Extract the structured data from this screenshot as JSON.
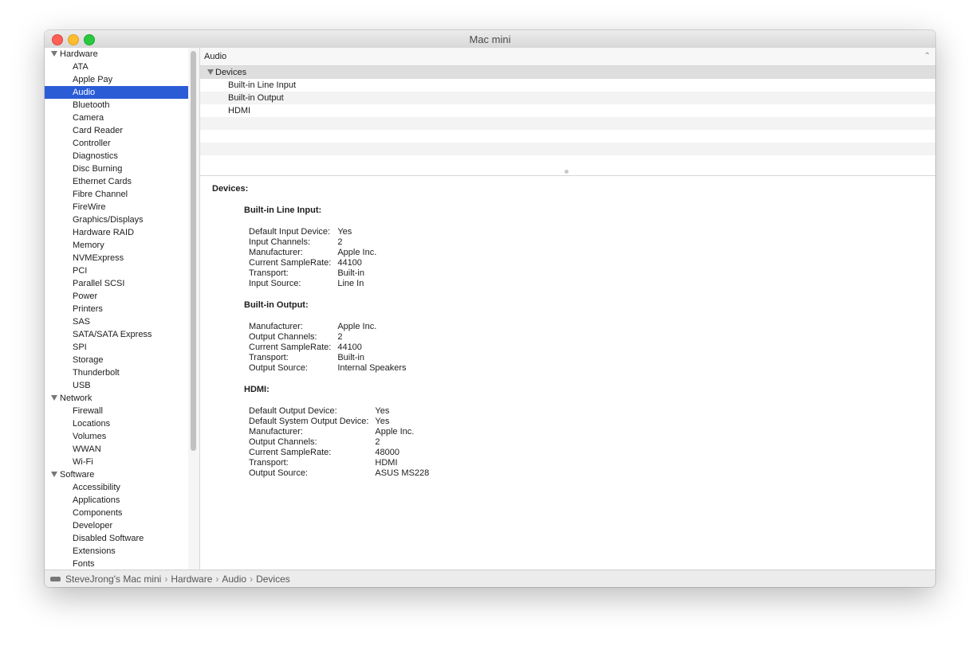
{
  "window": {
    "title": "Mac mini"
  },
  "sidebar": {
    "groups": [
      {
        "label": "Hardware",
        "items": [
          "ATA",
          "Apple Pay",
          "Audio",
          "Bluetooth",
          "Camera",
          "Card Reader",
          "Controller",
          "Diagnostics",
          "Disc Burning",
          "Ethernet Cards",
          "Fibre Channel",
          "FireWire",
          "Graphics/Displays",
          "Hardware RAID",
          "Memory",
          "NVMExpress",
          "PCI",
          "Parallel SCSI",
          "Power",
          "Printers",
          "SAS",
          "SATA/SATA Express",
          "SPI",
          "Storage",
          "Thunderbolt",
          "USB"
        ]
      },
      {
        "label": "Network",
        "items": [
          "Firewall",
          "Locations",
          "Volumes",
          "WWAN",
          "Wi-Fi"
        ]
      },
      {
        "label": "Software",
        "items": [
          "Accessibility",
          "Applications",
          "Components",
          "Developer",
          "Disabled Software",
          "Extensions",
          "Fonts"
        ]
      }
    ],
    "selected": "Audio"
  },
  "main": {
    "header": "Audio",
    "device_group": "Devices",
    "devices": [
      "Built-in Line Input",
      "Built-in Output",
      "HDMI"
    ],
    "details": {
      "heading": "Devices:",
      "sections": [
        {
          "title": "Built-in Line Input:",
          "rows": [
            [
              "Default Input Device:",
              "Yes"
            ],
            [
              "Input Channels:",
              "2"
            ],
            [
              "Manufacturer:",
              "Apple Inc."
            ],
            [
              "Current SampleRate:",
              "44100"
            ],
            [
              "Transport:",
              "Built-in"
            ],
            [
              "Input Source:",
              "Line In"
            ]
          ]
        },
        {
          "title": "Built-in Output:",
          "rows": [
            [
              "Manufacturer:",
              "Apple Inc."
            ],
            [
              "Output Channels:",
              "2"
            ],
            [
              "Current SampleRate:",
              "44100"
            ],
            [
              "Transport:",
              "Built-in"
            ],
            [
              "Output Source:",
              "Internal Speakers"
            ]
          ]
        },
        {
          "title": "HDMI:",
          "rows": [
            [
              "Default Output Device:",
              "Yes"
            ],
            [
              "Default System Output Device:",
              "Yes"
            ],
            [
              "Manufacturer:",
              "Apple Inc."
            ],
            [
              "Output Channels:",
              "2"
            ],
            [
              "Current SampleRate:",
              "48000"
            ],
            [
              "Transport:",
              "HDMI"
            ],
            [
              "Output Source:",
              "ASUS MS228"
            ]
          ]
        }
      ]
    }
  },
  "statusbar": {
    "crumbs": [
      "SteveJrong's Mac mini",
      "Hardware",
      "Audio",
      "Devices"
    ],
    "separator": "›"
  },
  "icons": {
    "traffic_lights": [
      "close-icon",
      "minimize-icon",
      "zoom-icon"
    ],
    "disclosure": "disclosure-triangle-icon",
    "computer": "mac-mini-icon"
  },
  "colors": {
    "selection": "#2a5cd6",
    "close": "#fe5f57",
    "minimize": "#febc2e",
    "zoom": "#28c840"
  }
}
